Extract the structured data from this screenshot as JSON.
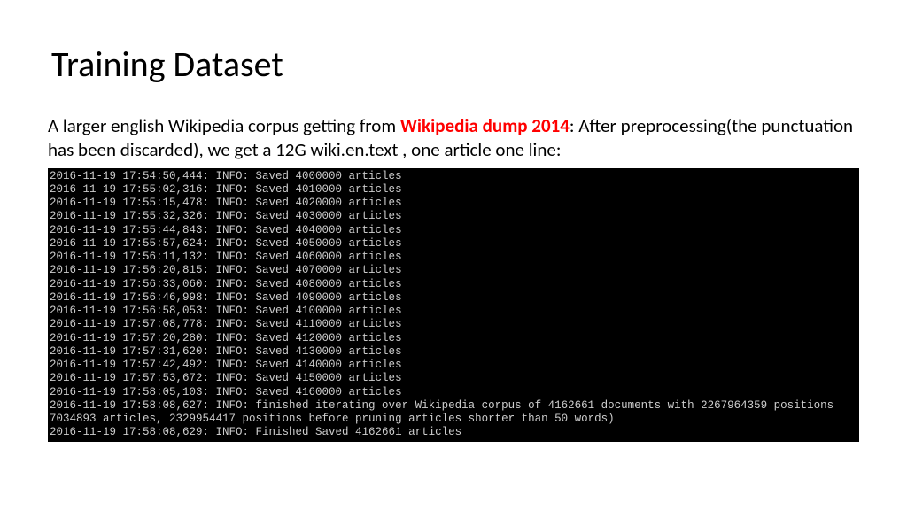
{
  "title": "Training Dataset",
  "paragraph": {
    "prefix": "A larger english Wikipedia corpus getting from ",
    "highlight": "Wikipedia dump 2014",
    "suffix": ": After preprocessing(the punctuation has been discarded), we get a 12G wiki.en.text , one article one line:"
  },
  "terminal_lines": [
    "2016-11-19 17:54:50,444: INFO: Saved 4000000 articles",
    "2016-11-19 17:55:02,316: INFO: Saved 4010000 articles",
    "2016-11-19 17:55:15,478: INFO: Saved 4020000 articles",
    "2016-11-19 17:55:32,326: INFO: Saved 4030000 articles",
    "2016-11-19 17:55:44,843: INFO: Saved 4040000 articles",
    "2016-11-19 17:55:57,624: INFO: Saved 4050000 articles",
    "2016-11-19 17:56:11,132: INFO: Saved 4060000 articles",
    "2016-11-19 17:56:20,815: INFO: Saved 4070000 articles",
    "2016-11-19 17:56:33,060: INFO: Saved 4080000 articles",
    "2016-11-19 17:56:46,998: INFO: Saved 4090000 articles",
    "2016-11-19 17:56:58,053: INFO: Saved 4100000 articles",
    "2016-11-19 17:57:08,778: INFO: Saved 4110000 articles",
    "2016-11-19 17:57:20,280: INFO: Saved 4120000 articles",
    "2016-11-19 17:57:31,620: INFO: Saved 4130000 articles",
    "2016-11-19 17:57:42,492: INFO: Saved 4140000 articles",
    "2016-11-19 17:57:53,672: INFO: Saved 4150000 articles",
    "2016-11-19 17:58:05,103: INFO: Saved 4160000 articles",
    "2016-11-19 17:58:08,627: INFO: finished iterating over Wikipedia corpus of 4162661 documents with 2267964359 positions",
    "7034893 articles, 2329954417 positions before pruning articles shorter than 50 words)",
    "2016-11-19 17:58:08,629: INFO: Finished Saved 4162661 articles"
  ]
}
